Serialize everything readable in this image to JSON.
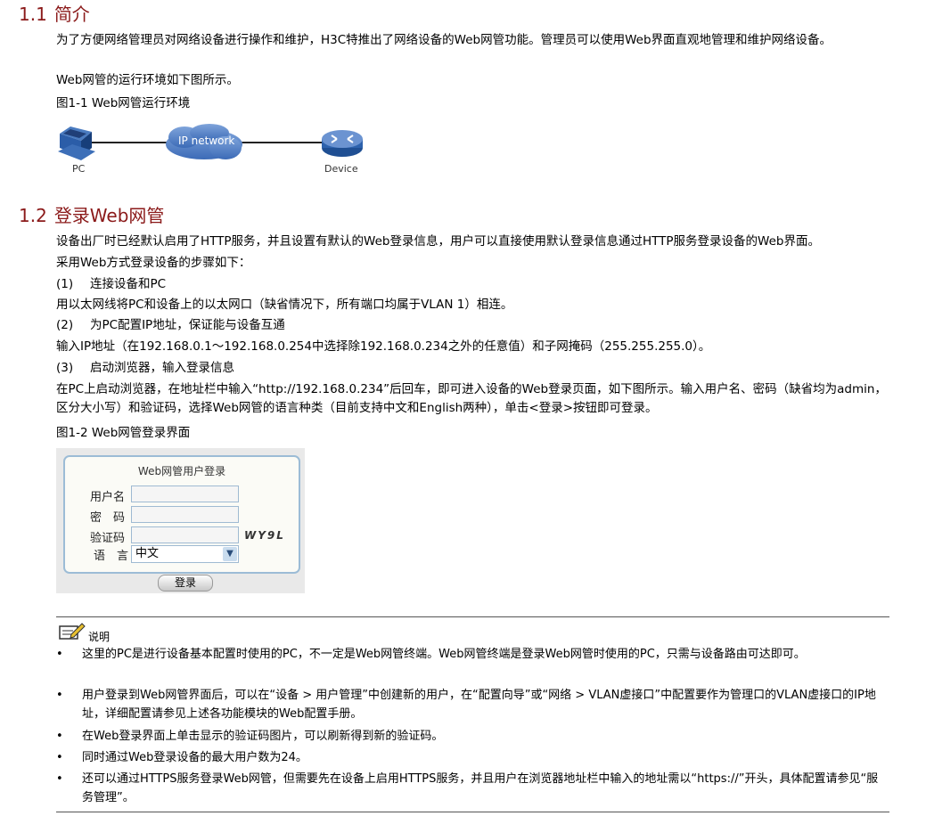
{
  "section1": {
    "number": "1.1",
    "title": "简介",
    "para1": "为了方便网络管理员对网络设备进行操作和维护，H3C特推出了网络设备的Web网管功能。管理员可以使用Web界面直观地管理和维护网络设备。",
    "para2": "Web网管的运行环境如下图所示。",
    "figure_caption": "图1-1 Web网管运行环境",
    "figure": {
      "pc_label": "PC",
      "cloud_label": "IP network",
      "device_label": "Device"
    }
  },
  "section2": {
    "number": "1.2",
    "title": "登录Web网管",
    "para1": "设备出厂时已经默认启用了HTTP服务，并且设置有默认的Web登录信息，用户可以直接使用默认登录信息通过HTTP服务登录设备的Web界面。",
    "para2": "采用Web方式登录设备的步骤如下：",
    "steps": [
      {
        "num": "(1)",
        "title": "连接设备和PC",
        "desc": "用以太网线将PC和设备上的以太网口（缺省情况下，所有端口均属于VLAN 1）相连。"
      },
      {
        "num": "(2)",
        "title": "为PC配置IP地址，保证能与设备互通",
        "desc": "输入IP地址（在192.168.0.1～192.168.0.254中选择除192.168.0.234之外的任意值）和子网掩码（255.255.255.0）。"
      },
      {
        "num": "(3)",
        "title": "启动浏览器，输入登录信息",
        "desc": "在PC上启动浏览器，在地址栏中输入“http://192.168.0.234”后回车，即可进入设备的Web登录页面，如下图所示。输入用户名、密码（缺省均为admin，区分大小写）和验证码，选择Web网管的语言种类（目前支持中文和English两种），单击<登录>按钮即可登录。"
      }
    ],
    "figure_caption": "图1-2 Web网管登录界面",
    "login": {
      "title": "Web网管用户登录",
      "username_label": "用户名",
      "password_label": "密　码",
      "captcha_label": "验证码",
      "language_label": "语　言",
      "captcha_code": "WY9L",
      "language_value": "中文",
      "login_button": "登录"
    }
  },
  "note": {
    "title": "说明",
    "items": [
      "这里的PC是进行设备基本配置时使用的PC，不一定是Web网管终端。Web网管终端是登录Web网管时使用的PC，只需与设备路由可达即可。",
      "用户登录到Web网管界面后，可以在“设备 > 用户管理”中创建新的用户，在“配置向导”或“网络 > VLAN虚接口”中配置要作为管理口的VLAN虚接口的IP地址，详细配置请参见上述各功能模块的Web配置手册。",
      "在Web登录界面上单击显示的验证码图片，可以刷新得到新的验证码。",
      "同时通过Web登录设备的最大用户数为24。",
      "还可以通过HTTPS服务登录Web网管，但需要先在设备上启用HTTPS服务，并且用户在浏览器地址栏中输入的地址需以“https://”开头，具体配置请参见“服务管理”。"
    ]
  }
}
